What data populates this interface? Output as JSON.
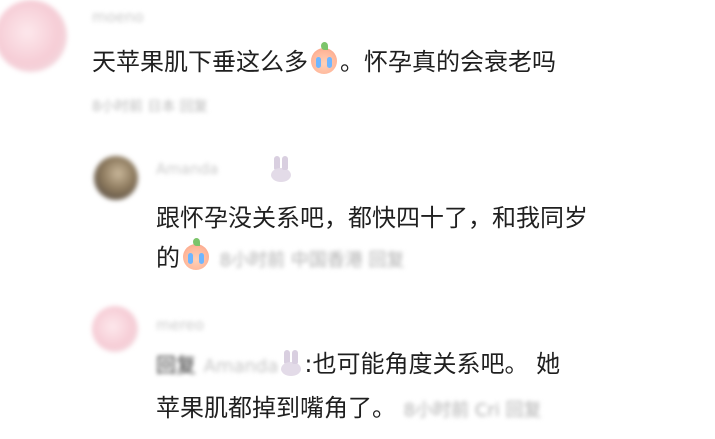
{
  "comments": [
    {
      "username": "moeno",
      "text": "天苹果肌下垂这么多",
      "emoji": "crying-face-emoji",
      "text_after_emoji": "。怀孕真的会衰老吗",
      "meta": "8小时前 日本 回复"
    },
    {
      "username": "Amanda",
      "line1": "跟怀孕没关系吧，都快四十了，和我同岁",
      "line2_prefix": "的",
      "meta": "8小时前 中国香港 回复"
    },
    {
      "username": "mereo",
      "reply_prefix": "回复",
      "reply_to": "Amanda",
      "line1_text": ":也可能角度关系吧。 她",
      "line2": "苹果肌都掉到嘴角了。",
      "meta": "8小时前 Cri 回复"
    }
  ]
}
